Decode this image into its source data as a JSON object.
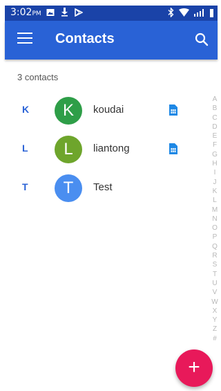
{
  "status_bar": {
    "time": "3:02",
    "ampm": "PM",
    "left_icons": [
      "image-icon",
      "download-icon",
      "play-store-icon"
    ],
    "right_icons": [
      "bluetooth-icon",
      "wifi-icon",
      "signal-icon",
      "battery-icon"
    ]
  },
  "app_bar": {
    "title": "Contacts",
    "menu_icon": "hamburger-menu-icon",
    "search_icon": "search-icon"
  },
  "contacts_count": "3 contacts",
  "contacts": [
    {
      "section": "K",
      "initial": "K",
      "name": "koudai",
      "avatar_color": "#2e9e48",
      "sim": true
    },
    {
      "section": "L",
      "initial": "L",
      "name": "liantong",
      "avatar_color": "#6ea52c",
      "sim": true
    },
    {
      "section": "T",
      "initial": "T",
      "name": "Test",
      "avatar_color": "#4a8ef0",
      "sim": false
    }
  ],
  "index_letters": [
    "A",
    "B",
    "C",
    "D",
    "E",
    "F",
    "G",
    "H",
    "I",
    "J",
    "K",
    "L",
    "M",
    "N",
    "O",
    "P",
    "Q",
    "R",
    "S",
    "T",
    "U",
    "V",
    "W",
    "X",
    "Y",
    "Z",
    "#"
  ],
  "fab": {
    "label": "+",
    "color": "#e8195a"
  },
  "colors": {
    "primary": "#2962d6",
    "status_bar": "#1a43a8",
    "sim_icon": "#1e88e5"
  }
}
